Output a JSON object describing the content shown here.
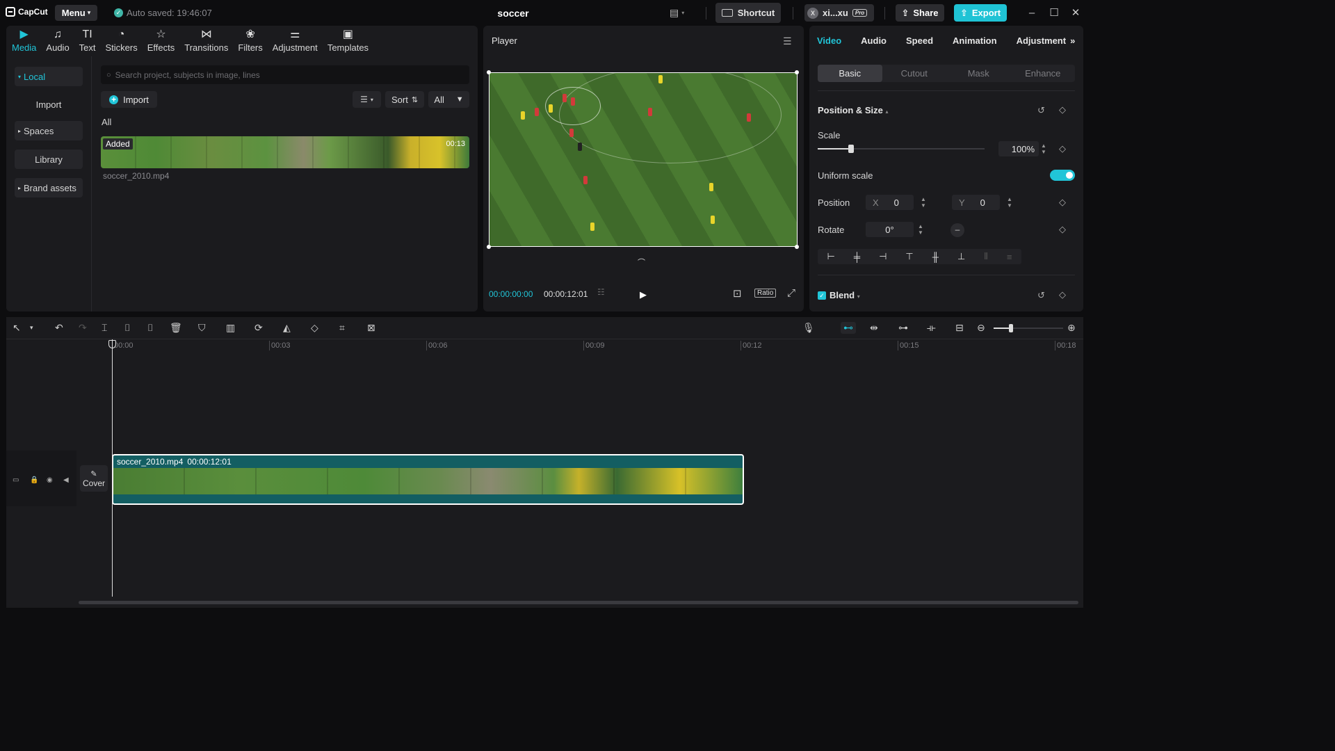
{
  "app": {
    "logo_text": "CapCut",
    "menu_label": "Menu",
    "autosave_text": "Auto saved: 19:46:07",
    "project_title": "soccer",
    "shortcut_label": "Shortcut",
    "user_initial": "X",
    "user_name": "xi...xu",
    "pro_badge": "Pro",
    "share_label": "Share",
    "export_label": "Export",
    "accent_color": "#1fc3d5"
  },
  "media_tabs": [
    {
      "label": "Media",
      "icon": "media-icon",
      "active": true
    },
    {
      "label": "Audio",
      "icon": "audio-icon"
    },
    {
      "label": "Text",
      "icon": "text-icon"
    },
    {
      "label": "Stickers",
      "icon": "stickers-icon"
    },
    {
      "label": "Effects",
      "icon": "effects-icon"
    },
    {
      "label": "Transitions",
      "icon": "transitions-icon"
    },
    {
      "label": "Filters",
      "icon": "filters-icon"
    },
    {
      "label": "Adjustment",
      "icon": "adjustment-icon"
    },
    {
      "label": "Templates",
      "icon": "templates-icon"
    }
  ],
  "sidebar": {
    "local": "Local",
    "import": "Import",
    "spaces": "Spaces",
    "library": "Library",
    "brand_assets": "Brand assets"
  },
  "media": {
    "search_placeholder": "Search project, subjects in image, lines",
    "import_label": "Import",
    "sort_label": "Sort",
    "filter_label": "All",
    "section_label": "All",
    "item": {
      "added_badge": "Added",
      "duration": "00:13",
      "filename": "soccer_2010.mp4"
    }
  },
  "player": {
    "title": "Player",
    "current_time": "00:00:00:00",
    "total_time": "00:00:12:01",
    "ratio_label": "Ratio"
  },
  "props": {
    "tabs": [
      "Video",
      "Audio",
      "Speed",
      "Animation",
      "Adjustment"
    ],
    "subtabs": [
      "Basic",
      "Cutout",
      "Mask",
      "Enhance"
    ],
    "section_title": "Position & Size",
    "scale_label": "Scale",
    "scale_value": "100%",
    "scale_fraction": 0.2,
    "uniform_scale_label": "Uniform scale",
    "uniform_scale_on": true,
    "position_label": "Position",
    "x_label": "X",
    "x_value": "0",
    "y_label": "Y",
    "y_value": "0",
    "rotate_label": "Rotate",
    "rotate_value": "0°",
    "blend_label": "Blend"
  },
  "timeline": {
    "ruler": [
      "00:00",
      "00:03",
      "00:06",
      "00:09",
      "00:12",
      "00:15",
      "00:18"
    ],
    "cover_label": "Cover",
    "clip_name": "soccer_2010.mp4",
    "clip_duration": "00:00:12:01",
    "zoom_fraction": 0.25
  }
}
